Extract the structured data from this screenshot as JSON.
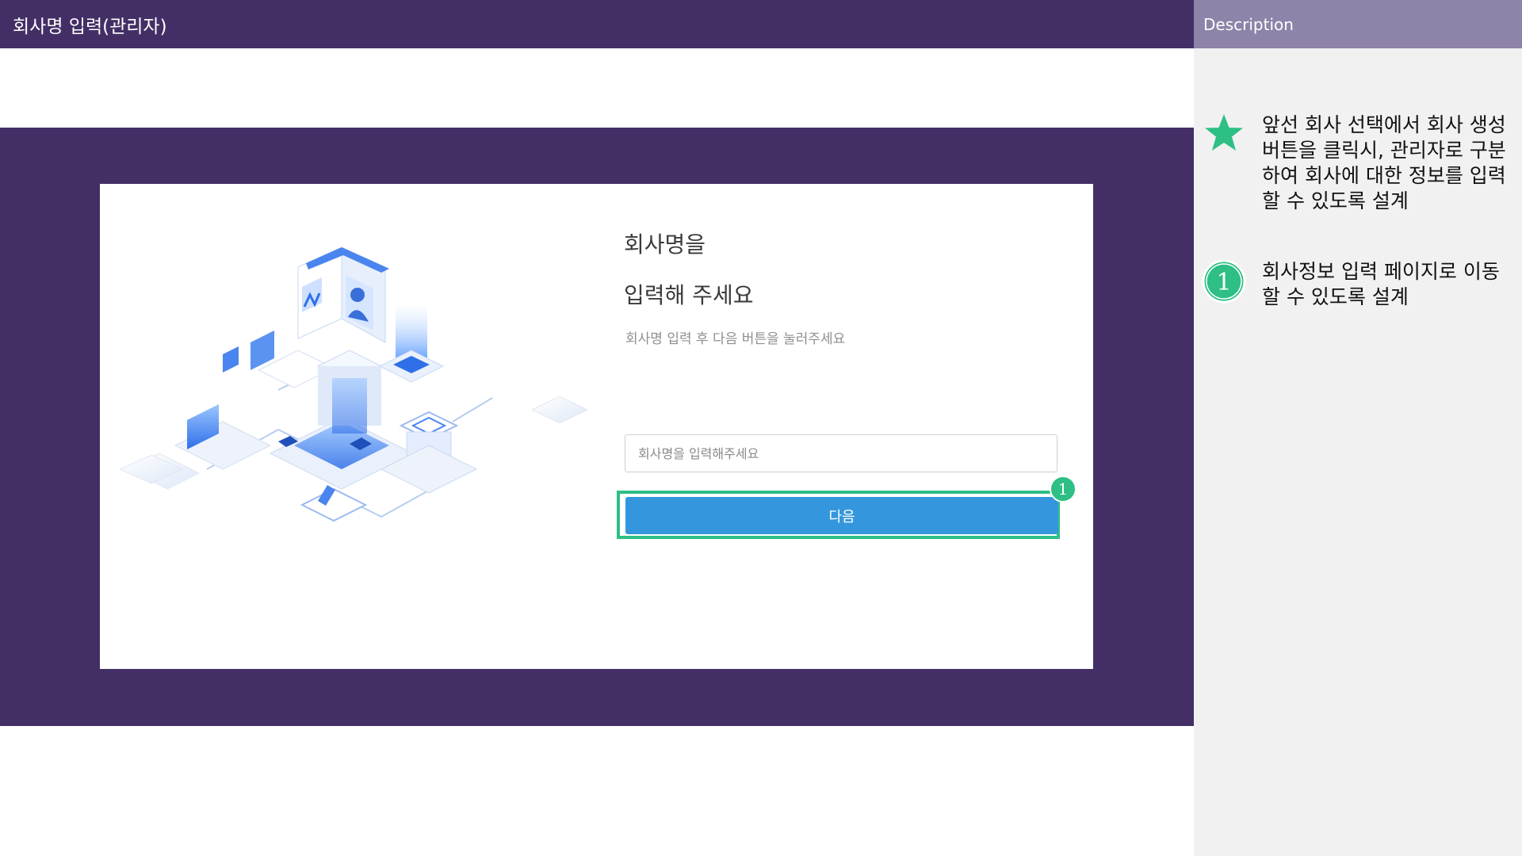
{
  "header": {
    "title": "회사명 입력(관리자)"
  },
  "form": {
    "heading_line1": "회사명을",
    "heading_line2": "입력해 주세요",
    "subtitle": "회사명 입력 후 다음 버튼을 눌러주세요",
    "input_placeholder": "회사명을 입력해주세요",
    "input_value": "",
    "next_label": "다음",
    "annotation_badge": "1"
  },
  "description": {
    "title": "Description",
    "items": [
      {
        "marker": "star-icon",
        "text": "앞선 회사 선택에서 회사 생성 버튼을 클릭시, 관리자로 구분하여 회사에 대한 정보를 입력할 수 있도록 설계"
      },
      {
        "marker": "1",
        "text": "회사정보 입력 페이지로 이동할 수 있도록 설계"
      }
    ]
  },
  "colors": {
    "brand_purple": "#432f66",
    "panel_header": "#8e83a8",
    "primary_button": "#3497dd",
    "annotation_green": "#2dbf84"
  }
}
